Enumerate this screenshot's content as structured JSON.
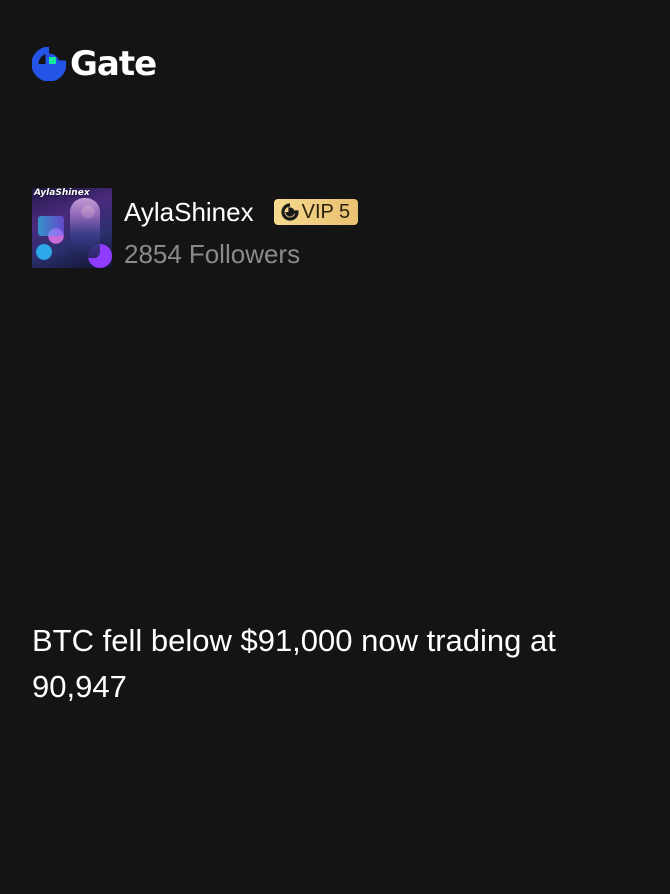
{
  "brand": {
    "name": "Gate",
    "colors": {
      "blue": "#2354e6",
      "green": "#17e6a1",
      "text": "#ffffff"
    }
  },
  "author": {
    "avatar_caption": "AylaShinex",
    "name": "AylaShinex",
    "vip_label": "VIP 5",
    "followers_count": "2854",
    "followers_label": "Followers"
  },
  "post": {
    "text": "BTC fell below $91,000 now trading at 90,947"
  },
  "theme": {
    "background": "#141414",
    "secondary_text": "#8a8a8a",
    "vip_gold": "#f6d98e"
  }
}
